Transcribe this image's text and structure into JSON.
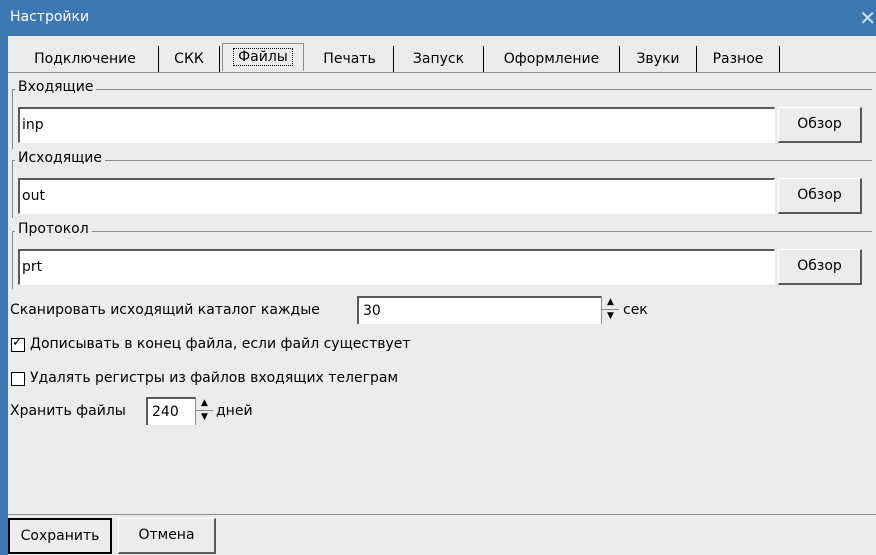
{
  "window": {
    "title": "Настройки",
    "close_glyph": "✕"
  },
  "tabs": [
    {
      "label": "Подключение"
    },
    {
      "label": "СКК"
    },
    {
      "label": "Файлы",
      "active": true
    },
    {
      "label": "Печать"
    },
    {
      "label": "Запуск"
    },
    {
      "label": "Оформление"
    },
    {
      "label": "Звуки"
    },
    {
      "label": "Разное"
    }
  ],
  "groups": {
    "incoming": {
      "legend": "Входящие",
      "value": "inp",
      "browse": "Обзор"
    },
    "outgoing": {
      "legend": "Исходящие",
      "value": "out",
      "browse": "Обзор"
    },
    "protocol": {
      "legend": "Протокол",
      "value": "prt",
      "browse": "Обзор"
    }
  },
  "scan": {
    "label": "Сканировать исходящий каталог каждые",
    "value": "30",
    "unit": "сек"
  },
  "append": {
    "label": "Дописывать в конец файла, если файл существует",
    "checked": true,
    "mark": "✓"
  },
  "remove_registers": {
    "label": "Удалять регистры из файлов входящих телеграм",
    "checked": false
  },
  "keep": {
    "label": "Хранить файлы",
    "value": "240",
    "unit": "дней"
  },
  "footer": {
    "save": "Сохранить",
    "cancel": "Отмена"
  }
}
